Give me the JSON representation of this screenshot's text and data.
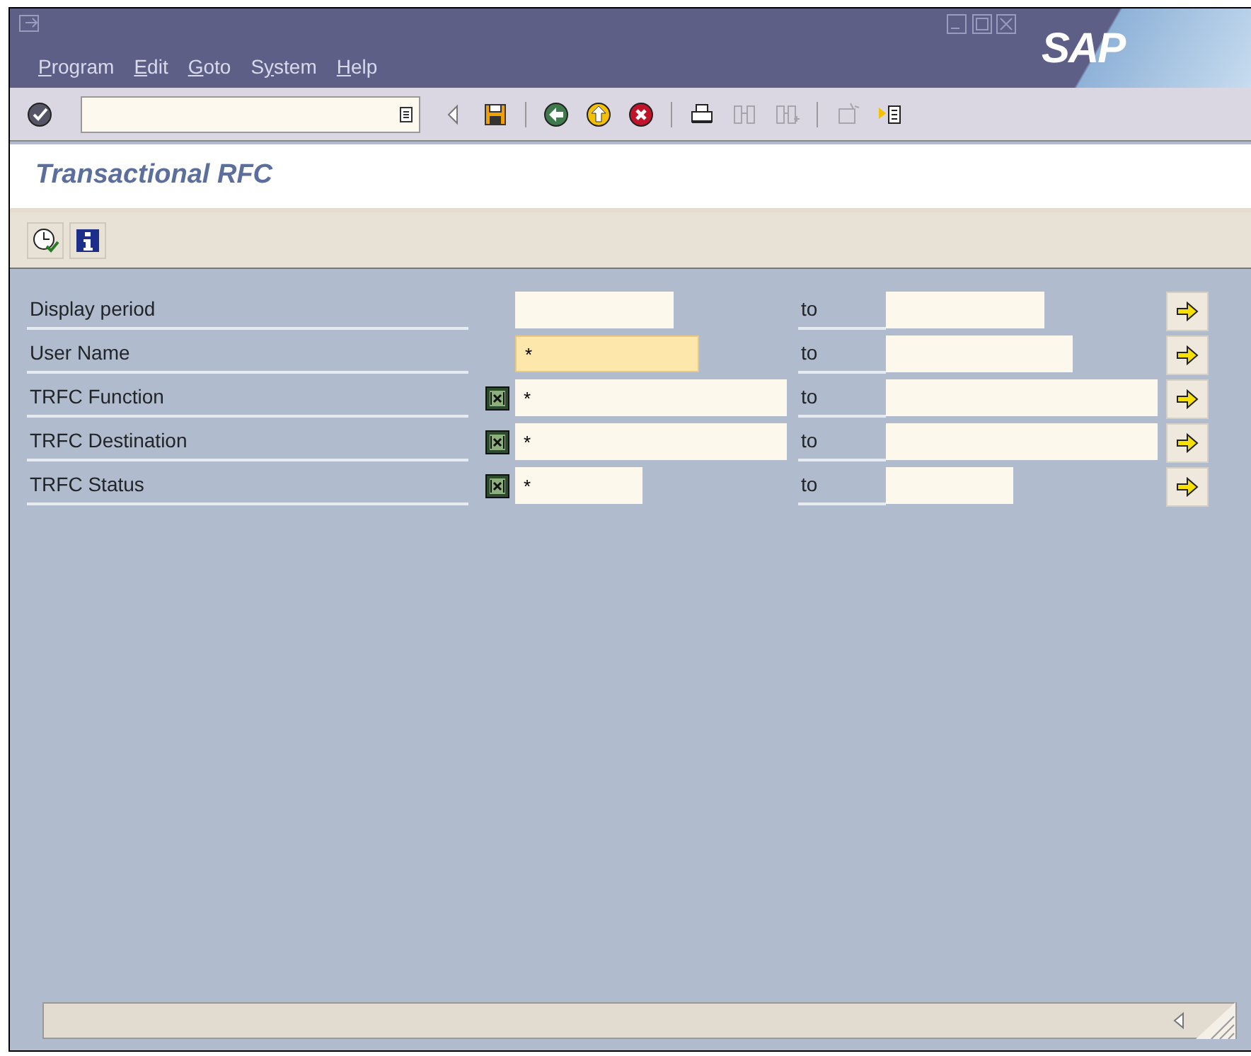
{
  "menu": [
    {
      "mnemonic": "P",
      "rest": "rogram"
    },
    {
      "mnemonic": "E",
      "rest": "dit"
    },
    {
      "mnemonic": "G",
      "rest": "oto"
    },
    {
      "lead": "S",
      "mnemonic": "y",
      "rest": "stem"
    },
    {
      "mnemonic": "H",
      "rest": "elp"
    }
  ],
  "logo": "SAP",
  "toolbar": [
    {
      "kind": "enter",
      "disabled": false
    },
    {
      "kind": "command"
    },
    {
      "kind": "prev",
      "disabled": false
    },
    {
      "kind": "save",
      "disabled": false
    },
    {
      "kind": "sep"
    },
    {
      "kind": "back",
      "disabled": false
    },
    {
      "kind": "exit",
      "disabled": false
    },
    {
      "kind": "cancel",
      "disabled": false
    },
    {
      "kind": "sep"
    },
    {
      "kind": "print",
      "disabled": false
    },
    {
      "kind": "find",
      "disabled": true
    },
    {
      "kind": "findnext",
      "disabled": true
    },
    {
      "kind": "sep"
    },
    {
      "kind": "session",
      "disabled": true
    },
    {
      "kind": "layout",
      "disabled": false
    }
  ],
  "title": "Transactional RFC",
  "app_toolbar": [
    {
      "kind": "execute"
    },
    {
      "kind": "info"
    }
  ],
  "fields": [
    {
      "label": "Display period",
      "multi": false,
      "from": {
        "focused": false
      },
      "to_label": "to"
    },
    {
      "label": "User Name",
      "multi": false,
      "from": {
        "value": "*",
        "focused": true
      },
      "to_label": "to"
    },
    {
      "label": "TRFC Function",
      "multi": true,
      "from": {
        "value": "*",
        "focused": false
      },
      "to_label": "to"
    },
    {
      "label": "TRFC Destination",
      "multi": true,
      "from": {
        "value": "*",
        "focused": false
      },
      "to_label": "to"
    },
    {
      "label": "TRFC Status",
      "multi": true,
      "from": {
        "value": "*",
        "focused": false
      },
      "to_label": "to"
    }
  ]
}
